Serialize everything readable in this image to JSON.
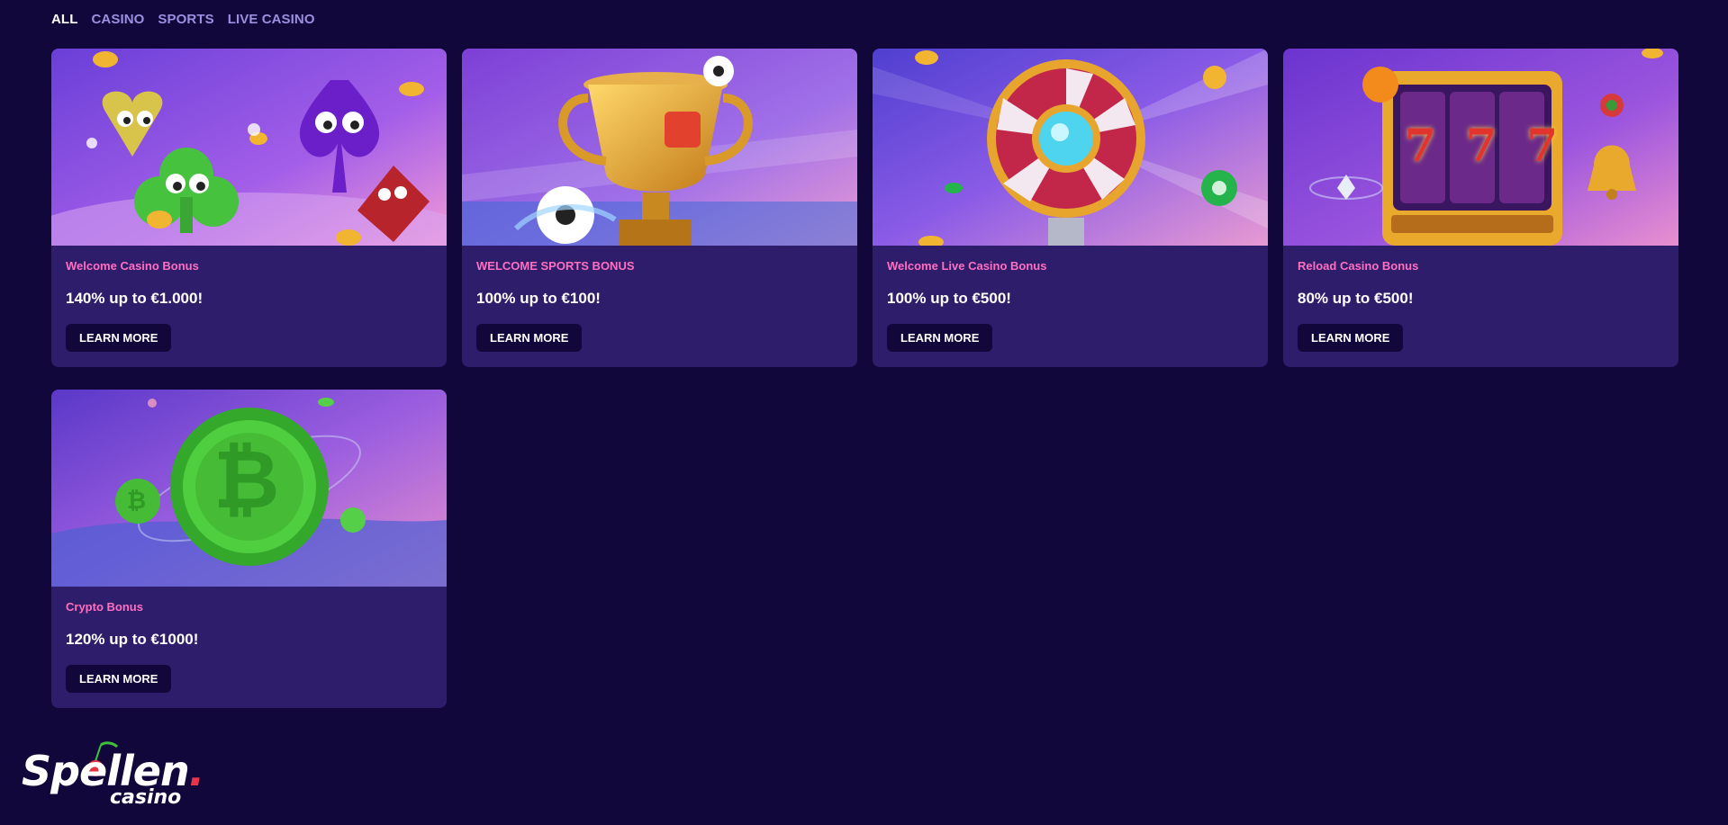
{
  "tabs": [
    {
      "label": "ALL",
      "active": true
    },
    {
      "label": "CASINO",
      "active": false
    },
    {
      "label": "SPORTS",
      "active": false
    },
    {
      "label": "LIVE CASINO",
      "active": false
    }
  ],
  "cards": [
    {
      "category": "Welcome Casino Bonus",
      "offer": "140% up to €1.000!",
      "button": "LEARN MORE",
      "image_icon": "card-suits-characters"
    },
    {
      "category": "WELCOME SPORTS BONUS",
      "offer": "100% up to €100!",
      "button": "LEARN MORE",
      "image_icon": "trophy-footballs"
    },
    {
      "category": "Welcome Live Casino Bonus",
      "offer": "100% up to €500!",
      "button": "LEARN MORE",
      "image_icon": "roulette-wheel"
    },
    {
      "category": "Reload Casino Bonus",
      "offer": "80% up to €500!",
      "button": "LEARN MORE",
      "image_icon": "slot-machine-777"
    },
    {
      "category": "Crypto Bonus",
      "offer": "120% up to €1000!",
      "button": "LEARN MORE",
      "image_icon": "bitcoin-coin"
    }
  ],
  "logo": {
    "main": "Spellen",
    "dot": ".",
    "sub": "casino"
  },
  "colors": {
    "background": "#12073b",
    "card": "#2e1d6b",
    "category_pink": "#ff6fc0",
    "tab_inactive": "#9b8fe0",
    "button_bg": "#12073b"
  }
}
